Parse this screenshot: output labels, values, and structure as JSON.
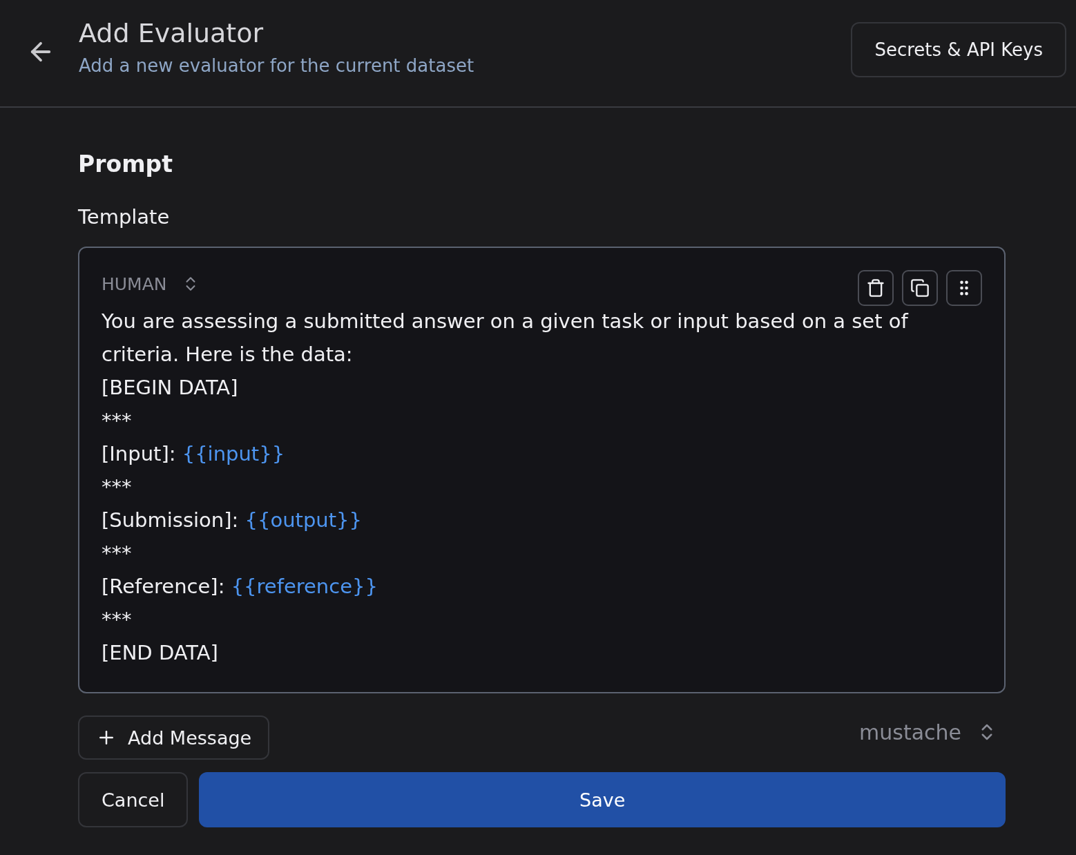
{
  "header": {
    "title": "Add Evaluator",
    "subtitle": "Add a new evaluator for the current dataset",
    "secrets_button": "Secrets & API Keys"
  },
  "prompt": {
    "heading": "Prompt",
    "template_label": "Template",
    "message": {
      "role": "HUMAN",
      "lines": [
        {
          "text": "You are assessing a submitted answer on a given task or input based on a set of criteria. Here is the data:"
        },
        {
          "text": "[BEGIN DATA]"
        },
        {
          "text": "***"
        },
        {
          "text": "[Input]: ",
          "variable": "{{input}}"
        },
        {
          "text": "***"
        },
        {
          "text": "[Submission]: ",
          "variable": "{{output}}"
        },
        {
          "text": "***"
        },
        {
          "text": "[Reference]: ",
          "variable": "{{reference}}"
        },
        {
          "text": "***"
        },
        {
          "text": "[END DATA]"
        }
      ]
    },
    "add_message_button": "Add Message",
    "template_format": "mustache"
  },
  "actions": {
    "cancel": "Cancel",
    "save": "Save"
  }
}
